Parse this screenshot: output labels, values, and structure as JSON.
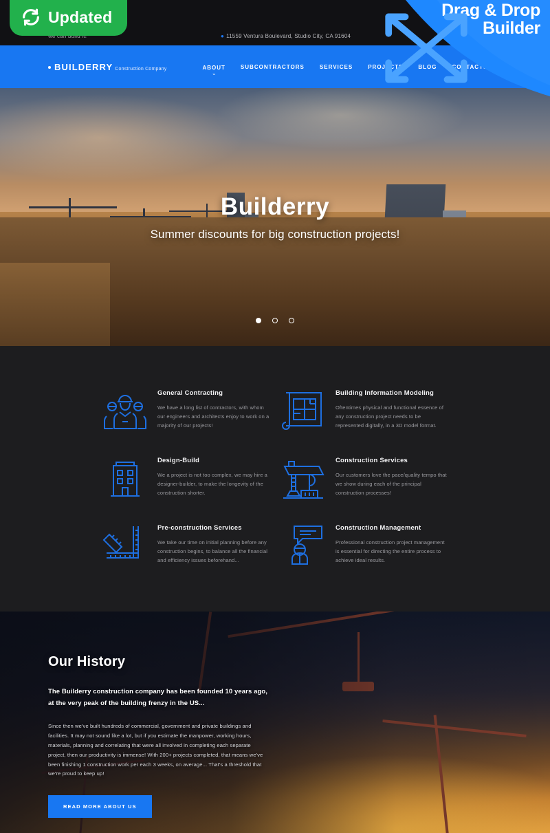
{
  "promo": {
    "badge_label": "Updated",
    "badge_icon": "refresh-icon",
    "ribbon_line1": "Drag & Drop",
    "ribbon_line2": "Builder",
    "ribbon_icon": "four-way-drag-arrow-icon",
    "badge_color": "#22b14c",
    "ribbon_color": "#1e88ff"
  },
  "topbar": {
    "slogan": "we can build it!",
    "address": "11559 Ventura Boulevard, Studio City, CA 91604",
    "pin_icon": "location-pin-icon",
    "social": [
      {
        "name": "facebook-icon",
        "glyph": "f"
      },
      {
        "name": "twitter-icon",
        "glyph": "✒"
      }
    ]
  },
  "header": {
    "logo_name": "BUILDERRY",
    "logo_sub": "Construction Company",
    "nav": [
      {
        "label": "ABOUT",
        "has_dropdown": true
      },
      {
        "label": "SUBCONTRACTORS",
        "has_dropdown": false
      },
      {
        "label": "SERVICES",
        "has_dropdown": false
      },
      {
        "label": "PROJECTS",
        "has_dropdown": false
      },
      {
        "label": "BLOG",
        "has_dropdown": false
      },
      {
        "label": "CONTACTS",
        "has_dropdown": false
      }
    ],
    "caret_icon": "chevron-down-icon",
    "accent": "#1877f2"
  },
  "hero": {
    "title": "Builderry",
    "subtitle": "Summer discounts for big construction projects!",
    "slides": [
      {
        "index": 1,
        "active": true
      },
      {
        "index": 2,
        "active": false
      },
      {
        "index": 3,
        "active": false
      }
    ]
  },
  "services": [
    {
      "icon": "construction-workers-icon",
      "title": "General Contracting",
      "desc": "We have a long list of contractors, with whom our engineers and architects enjoy to work on a majority of our projects!"
    },
    {
      "icon": "blueprint-icon",
      "title": "Building Information Modeling",
      "desc": "Oftentimes physical and functional essence of any construction project needs to be represented digitally, in a 3D model format."
    },
    {
      "icon": "building-icon",
      "title": "Design-Build",
      "desc": "We a project is not too complex, we may hire a designer-builder, to make the longevity of the construction shorter."
    },
    {
      "icon": "tower-crane-icon",
      "title": "Construction Services",
      "desc": "Our customers love the pace/quality tempo that we show during each of the principal construction processes!"
    },
    {
      "icon": "ruler-square-icon",
      "title": "Pre-construction Services",
      "desc": "We take our time on initial planning before any construction begins, to balance all the financial and efficiency issues beforehand..."
    },
    {
      "icon": "manager-speech-icon",
      "title": "Construction Management",
      "desc": "Professional construction project management is essential for directing the entire process to achieve ideal results."
    }
  ],
  "history": {
    "title": "Our History",
    "lead": "The Builderry construction company has been founded 10 years ago, at the very peak of the building frenzy in the US...",
    "body": "Since then we've built hundreds of commercial, government and private buildings and facilities. It may not sound like a lot, but if you estimate the manpower, working hours, materials, planning and correlating that were all involved in completing each separate project, then our productivity is immense! With 200+ projects completed, that means we've been finishing 1 construction work per each 3 weeks, on average... That's a threshold that we're proud to keep up!",
    "button_label": "READ MORE ABOUT US"
  }
}
